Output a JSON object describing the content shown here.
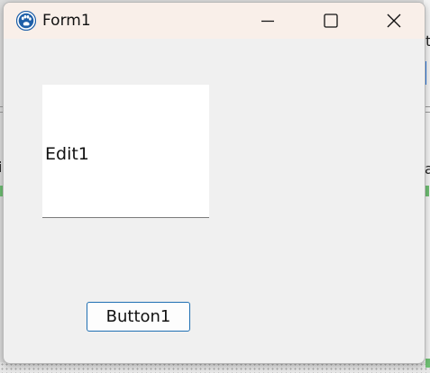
{
  "window": {
    "title": "Form1",
    "icon": "paw-icon",
    "controls": {
      "minimize_icon": "minimize-icon",
      "maximize_icon": "maximize-icon",
      "close_icon": "close-icon"
    }
  },
  "form": {
    "edit1": {
      "value": "Edit1"
    },
    "button1": {
      "label": "Button1"
    }
  },
  "background": {
    "fragment_left": "i",
    "fragment_right": "a",
    "fragment_top_right": "t"
  },
  "colors": {
    "titlebar": "#f9efe9",
    "window_body": "#f0f0f0",
    "button_border": "#1f6fb2",
    "icon_blue": "#1e5fa8"
  }
}
